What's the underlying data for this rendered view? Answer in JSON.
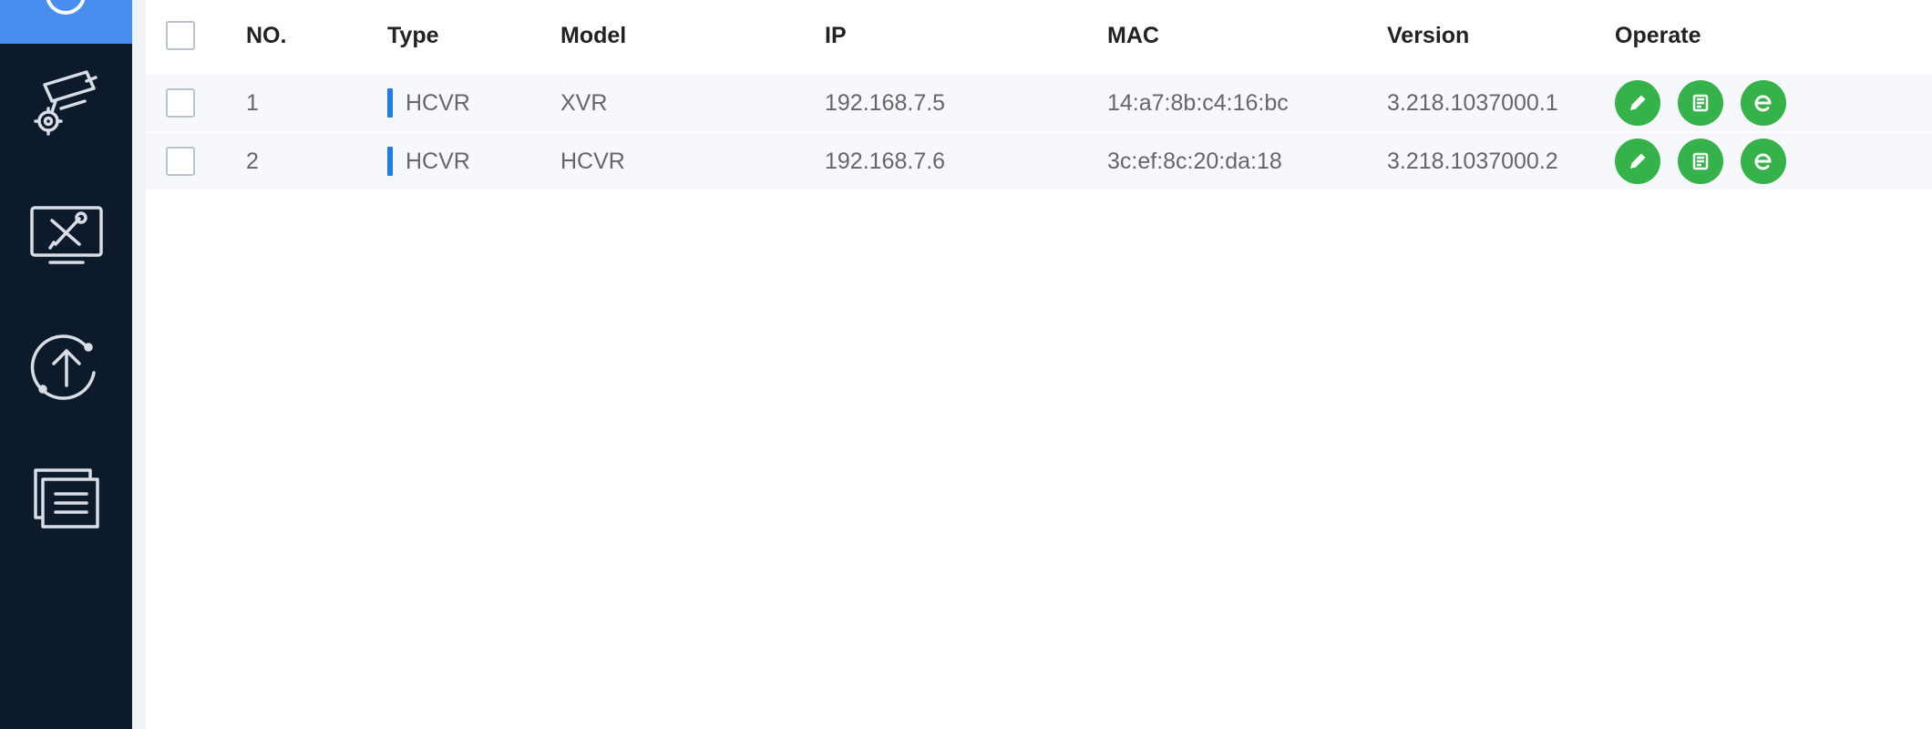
{
  "table": {
    "columns": {
      "no": "NO.",
      "type": "Type",
      "model": "Model",
      "ip": "IP",
      "mac": "MAC",
      "version": "Version",
      "operate": "Operate"
    },
    "rows": [
      {
        "no": "1",
        "type": "HCVR",
        "model": "XVR",
        "ip": "192.168.7.5",
        "mac": "14:a7:8b:c4:16:bc",
        "version": "3.218.1037000.1"
      },
      {
        "no": "2",
        "type": "HCVR",
        "model": "HCVR",
        "ip": "192.168.7.6",
        "mac": "3c:ef:8c:20:da:18",
        "version": "3.218.1037000.2"
      }
    ]
  },
  "icons": {
    "sidebar": [
      "settings-ring-icon",
      "camera-settings-icon",
      "device-maintenance-icon",
      "upgrade-icon",
      "windows-list-icon"
    ],
    "operate": [
      "edit-icon",
      "config-icon",
      "web-browser-icon"
    ]
  },
  "colors": {
    "sidebar_bg": "#0d1a2b",
    "sidebar_active": "#4a8df0",
    "type_marker": "#1f7bf0",
    "operate_button": "#36b24a"
  }
}
